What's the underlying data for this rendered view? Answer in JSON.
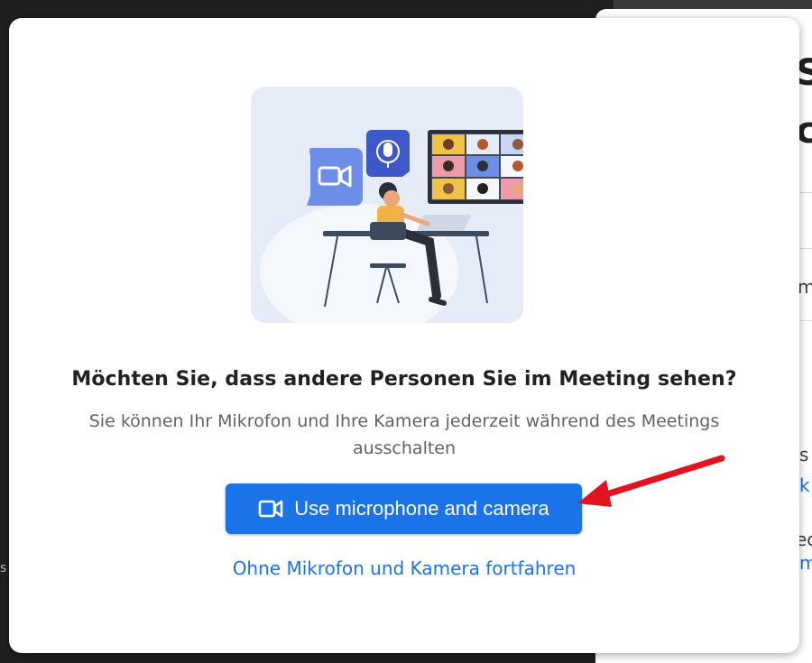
{
  "background": {
    "fragments": [
      "S",
      "c",
      "m",
      "s",
      "k",
      "ec",
      "m",
      "s"
    ]
  },
  "dialog": {
    "title": "Möchten Sie, dass andere Personen Sie im Meeting sehen?",
    "subtitle": "Sie können Ihr Mikrofon und Ihre Kamera jederzeit während des Meetings ausschalten",
    "primary_button_label": "Use microphone and camera",
    "secondary_link_label": "Ohne Mikrofon und Kamera fortfahren",
    "illustration_icon": "video-meeting-illustration"
  },
  "colors": {
    "accent": "#1a73e8",
    "annotation_arrow": "#e0131f"
  }
}
